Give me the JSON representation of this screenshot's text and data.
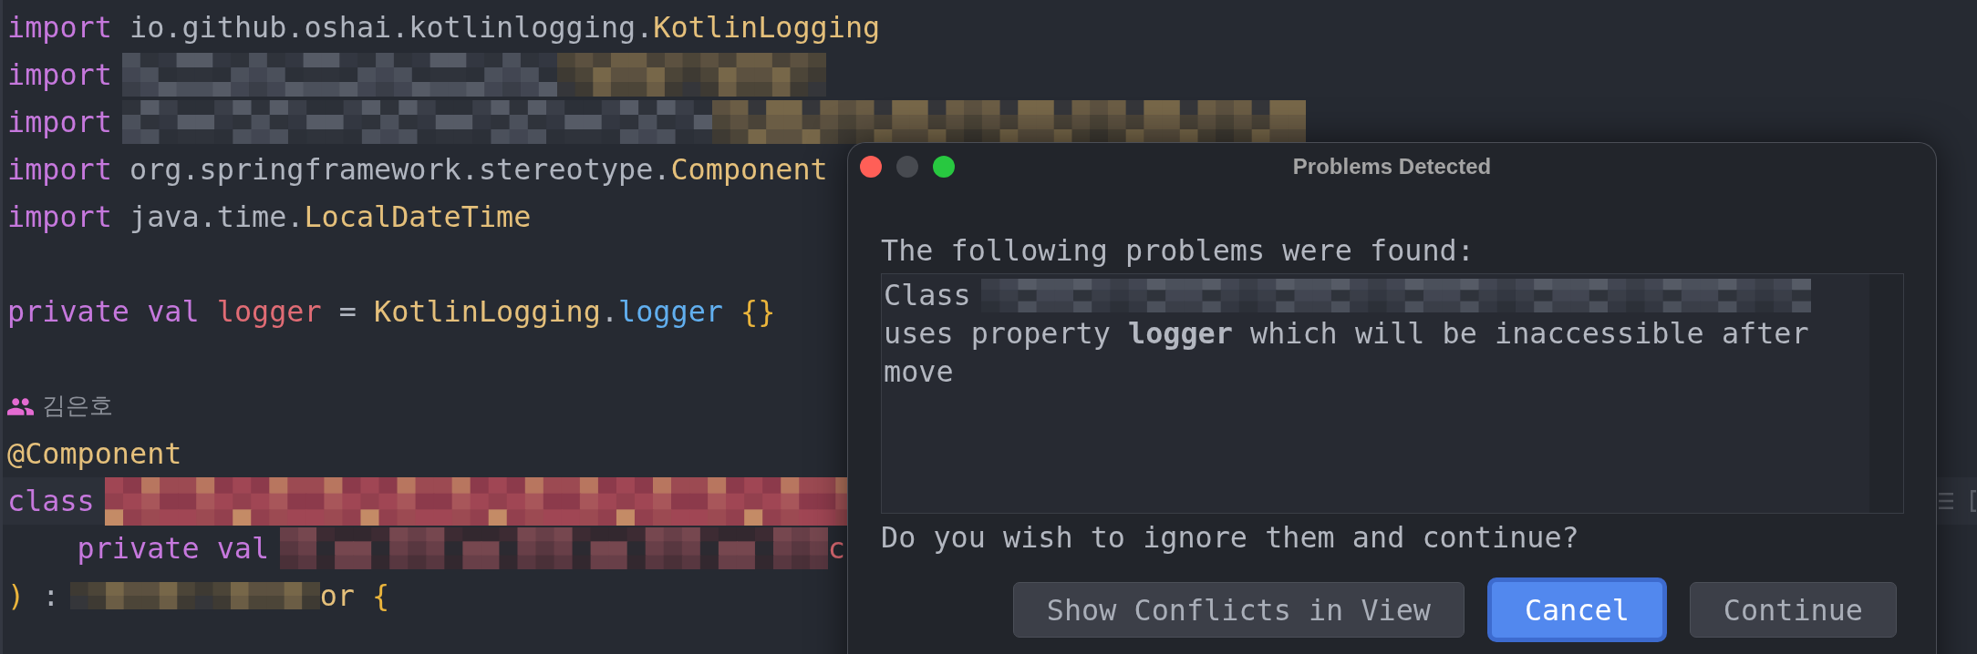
{
  "editor": {
    "lines": [
      {
        "kind": "code",
        "current": false,
        "tokens": [
          {
            "kind": "keyword",
            "text": "import",
            "redacted": false
          },
          {
            "kind": "plain",
            "text": " io.github.oshai.kotlinlogging.",
            "redacted": false
          },
          {
            "kind": "type",
            "text": "KotlinLogging",
            "redacted": false
          }
        ]
      },
      {
        "kind": "code",
        "current": false,
        "tokens": [
          {
            "kind": "keyword",
            "text": "import",
            "redacted": false
          },
          {
            "kind": "plain",
            "redacted": true
          },
          {
            "kind": "type",
            "redacted": true
          }
        ]
      },
      {
        "kind": "code",
        "current": false,
        "tokens": [
          {
            "kind": "keyword",
            "text": "import",
            "redacted": false
          },
          {
            "kind": "plain",
            "redacted": true
          },
          {
            "kind": "type",
            "redacted": true
          }
        ]
      },
      {
        "kind": "code",
        "current": false,
        "tokens": [
          {
            "kind": "keyword",
            "text": "import",
            "redacted": false
          },
          {
            "kind": "plain",
            "text": " org.springframework.stereotype.",
            "redacted": false
          },
          {
            "kind": "type",
            "text": "Component",
            "redacted": false
          }
        ]
      },
      {
        "kind": "code",
        "current": false,
        "tokens": [
          {
            "kind": "keyword",
            "text": "import",
            "redacted": false
          },
          {
            "kind": "plain",
            "text": " java.time.",
            "redacted": false
          },
          {
            "kind": "type",
            "text": "LocalDateTime",
            "redacted": false
          }
        ]
      },
      {
        "kind": "blank",
        "current": false
      },
      {
        "kind": "code",
        "current": false,
        "tokens": [
          {
            "kind": "keyword",
            "text": "private val ",
            "redacted": false
          },
          {
            "kind": "name",
            "text": "logger",
            "redacted": false
          },
          {
            "kind": "plain",
            "text": " = ",
            "redacted": false
          },
          {
            "kind": "type",
            "text": "KotlinLogging",
            "redacted": false
          },
          {
            "kind": "plain",
            "text": ".",
            "redacted": false
          },
          {
            "kind": "member",
            "text": "logger",
            "redacted": false
          },
          {
            "kind": "brace",
            "text": " {}",
            "redacted": false
          }
        ]
      },
      {
        "kind": "blank",
        "current": false
      },
      {
        "kind": "author",
        "current": false,
        "text": "김은호"
      },
      {
        "kind": "code",
        "current": false,
        "tokens": [
          {
            "kind": "annotation",
            "text": "@Component",
            "redacted": false
          }
        ]
      },
      {
        "kind": "code",
        "current": true,
        "tokens": [
          {
            "kind": "keyword",
            "text": "class",
            "redacted": false
          },
          {
            "kind": "classname",
            "redacted": true
          }
        ]
      },
      {
        "kind": "code",
        "current": false,
        "tokens": [
          {
            "kind": "keyword",
            "text": "    private val",
            "redacted": false
          },
          {
            "kind": "name",
            "redacted": true
          },
          {
            "kind": "name",
            "text": "c",
            "redacted": false
          }
        ]
      },
      {
        "kind": "code",
        "current": false,
        "tokens": [
          {
            "kind": "brace",
            "text": ")",
            "redacted": false
          },
          {
            "kind": "plain",
            "text": " :",
            "redacted": false
          },
          {
            "kind": "type",
            "redacted": true
          },
          {
            "kind": "type",
            "text": "or",
            "redacted": false
          },
          {
            "kind": "brace",
            "text": " {",
            "redacted": false
          }
        ]
      }
    ]
  },
  "dialog": {
    "title": "Problems Detected",
    "window_controls": [
      {
        "kind": "close",
        "enabled": true
      },
      {
        "kind": "minimize",
        "enabled": false
      },
      {
        "kind": "zoom",
        "enabled": true
      }
    ],
    "message": "The following problems were found:",
    "problems": [
      {
        "prefix": "Class",
        "subject_redacted": true,
        "text": "uses property **logger** which will be inaccessible after move"
      }
    ],
    "question": "Do you wish to ignore them and continue?",
    "buttons": [
      {
        "label": "Show Conflicts in View",
        "default": false
      },
      {
        "label": "Cancel",
        "default": true
      },
      {
        "label": "Continue",
        "default": false
      }
    ]
  }
}
